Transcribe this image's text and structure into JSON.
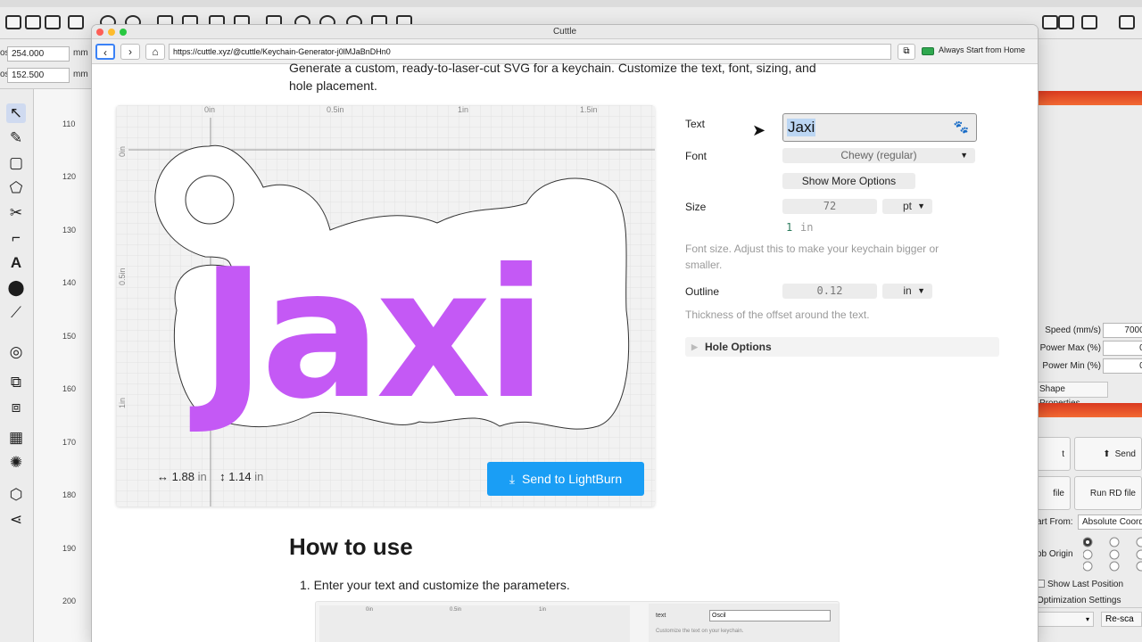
{
  "lightburn": {
    "coords": [
      {
        "label": "os",
        "value": "254.000",
        "unit": "mm"
      },
      {
        "label": "os",
        "value": "152.500",
        "unit": "mm"
      }
    ],
    "ruler_ticks": [
      "110",
      "120",
      "130",
      "140",
      "150",
      "160",
      "170",
      "180",
      "190",
      "200"
    ],
    "right_panel": {
      "fields": [
        {
          "label": "Speed (mm/s)",
          "value": "7000.0"
        },
        {
          "label": "Power Max (%)",
          "value": "0.0"
        },
        {
          "label": "Power Min (%)",
          "value": "0.0"
        }
      ],
      "shape_properties": "Shape Properties",
      "buttons": {
        "frame": "t",
        "send": "Send",
        "save_file": "file",
        "run_rd": "Run RD file"
      },
      "start_from_label": "art From:",
      "start_from_value": "Absolute Coord",
      "job_origin_label": "ob Origin",
      "show_last_position": "Show Last Position",
      "optimization_settings": "Optimization Settings",
      "rescale": "Re-sca"
    }
  },
  "browser": {
    "window_title": "Cuttle",
    "url": "https://cuttle.xyz/@cuttle/Keychain-Generator-j0lMJaBnDHn0",
    "always_start_label": "Always Start from Home"
  },
  "page": {
    "intro_line1": "Generate a custom, ready-to-laser-cut SVG for a keychain. Customize the text, font, sizing, and",
    "intro_line2": "hole placement.",
    "canvas": {
      "top_ruler": [
        "0in",
        "0.5in",
        "1in",
        "1.5in"
      ],
      "left_ruler": [
        "0in",
        "0.5in",
        "1in"
      ],
      "keychain_text": "Jaxi",
      "text_color": "#c459f5",
      "width_value": "1.88",
      "height_value": "1.14",
      "unit": "in",
      "send_button": "Send to LightBurn"
    },
    "params": {
      "text_label": "Text",
      "text_value": "Jaxi",
      "font_label": "Font",
      "font_value": "Chewy (regular)",
      "show_more": "Show More Options",
      "size_label": "Size",
      "size_value": "72",
      "size_unit": "pt",
      "size_in_value": "1",
      "size_in_unit": "in",
      "size_help_1": "Font size. Adjust this to make your keychain bigger or",
      "size_help_2": "smaller.",
      "outline_label": "Outline",
      "outline_value": "0.12",
      "outline_unit": "in",
      "outline_help": "Thickness of the offset around the text.",
      "hole_options": "Hole Options"
    },
    "howto_title": "How to use",
    "step1": "1. Enter your text and customize the parameters.",
    "preview": {
      "ticks": [
        "0in",
        "0.5in",
        "1in"
      ],
      "label": "text",
      "value": "Oscil",
      "help": "Customize the text on your keychain."
    }
  }
}
